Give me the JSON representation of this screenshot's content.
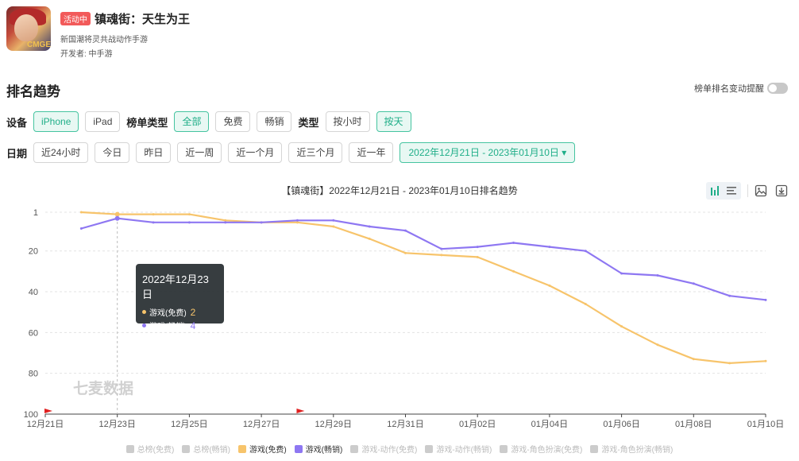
{
  "app": {
    "badge": "活动中",
    "title": "镇魂街：天生为王",
    "subtitle": "新国潮将灵共战动作手游",
    "developer": "开发者: 中手游",
    "icon_brand": "CMGE"
  },
  "section": {
    "title": "排名趋势",
    "alert_label": "榜单排名变动提醒"
  },
  "filters": {
    "device_label": "设备",
    "devices": [
      "iPhone",
      "iPad"
    ],
    "list_type_label": "榜单类型",
    "list_types": [
      "全部",
      "免费",
      "畅销"
    ],
    "type_label": "类型",
    "types": [
      "按小时",
      "按天"
    ],
    "date_label": "日期",
    "date_presets": [
      "近24小时",
      "今日",
      "昨日",
      "近一周",
      "近一个月",
      "近三个月",
      "近一年"
    ],
    "date_range": "2022年12月21日 - 2023年01月10日 ▾"
  },
  "chart_title": "【镇魂街】2022年12月21日 - 2023年01月10日排名趋势",
  "watermark": "七麦数据",
  "tooltip": {
    "title": "2022年12月23日",
    "rows": [
      {
        "label": "游戏(免费)",
        "value": "2",
        "color": "#f7c46b"
      },
      {
        "label": "游戏(畅销)",
        "value": "4",
        "color": "#8e77f2"
      }
    ]
  },
  "legend": [
    {
      "label": "总榜(免费)",
      "active": false
    },
    {
      "label": "总榜(畅销)",
      "active": false
    },
    {
      "label": "游戏(免费)",
      "active": true,
      "color": "#f7c46b"
    },
    {
      "label": "游戏(畅销)",
      "active": true,
      "color": "#8e77f2"
    },
    {
      "label": "游戏-动作(免费)",
      "active": false
    },
    {
      "label": "游戏-动作(畅销)",
      "active": false
    },
    {
      "label": "游戏-角色扮演(免费)",
      "active": false
    },
    {
      "label": "游戏-角色扮演(畅销)",
      "active": false
    }
  ],
  "chart_data": {
    "type": "line",
    "title": "【镇魂街】2022年12月21日 - 2023年01月10日排名趋势",
    "x": [
      "12月21日",
      "12月22日",
      "12月23日",
      "12月24日",
      "12月25日",
      "12月26日",
      "12月27日",
      "12月28日",
      "12月29日",
      "12月30日",
      "12月31日",
      "01月01日",
      "01月02日",
      "01月03日",
      "01月04日",
      "01月05日",
      "01月06日",
      "01月07日",
      "01月08日",
      "01月09日",
      "01月10日"
    ],
    "x_tick_labels": [
      "12月21日",
      "12月23日",
      "12月25日",
      "12月27日",
      "12月29日",
      "12月31日",
      "01月02日",
      "01月04日",
      "01月06日",
      "01月08日",
      "01月10日"
    ],
    "y_tick_labels": [
      "1",
      "20",
      "40",
      "60",
      "80",
      "100"
    ],
    "ylim": [
      1,
      100
    ],
    "y_inverted": true,
    "grid": true,
    "series": [
      {
        "name": "游戏(免费)",
        "color": "#f7c46b",
        "values": [
          null,
          1,
          2,
          2,
          2,
          5,
          6,
          6,
          8,
          14,
          21,
          22,
          23,
          30,
          37,
          46,
          57,
          66,
          73,
          75,
          74
        ]
      },
      {
        "name": "游戏(畅销)",
        "color": "#8e77f2",
        "values": [
          null,
          9,
          4,
          6,
          6,
          6,
          6,
          5,
          5,
          8,
          10,
          19,
          18,
          16,
          18,
          20,
          31,
          32,
          36,
          42,
          44
        ]
      }
    ],
    "flags_at": [
      "12月21日",
      "12月28日"
    ],
    "hover_x": "12月23日",
    "legend_position": "bottom"
  }
}
